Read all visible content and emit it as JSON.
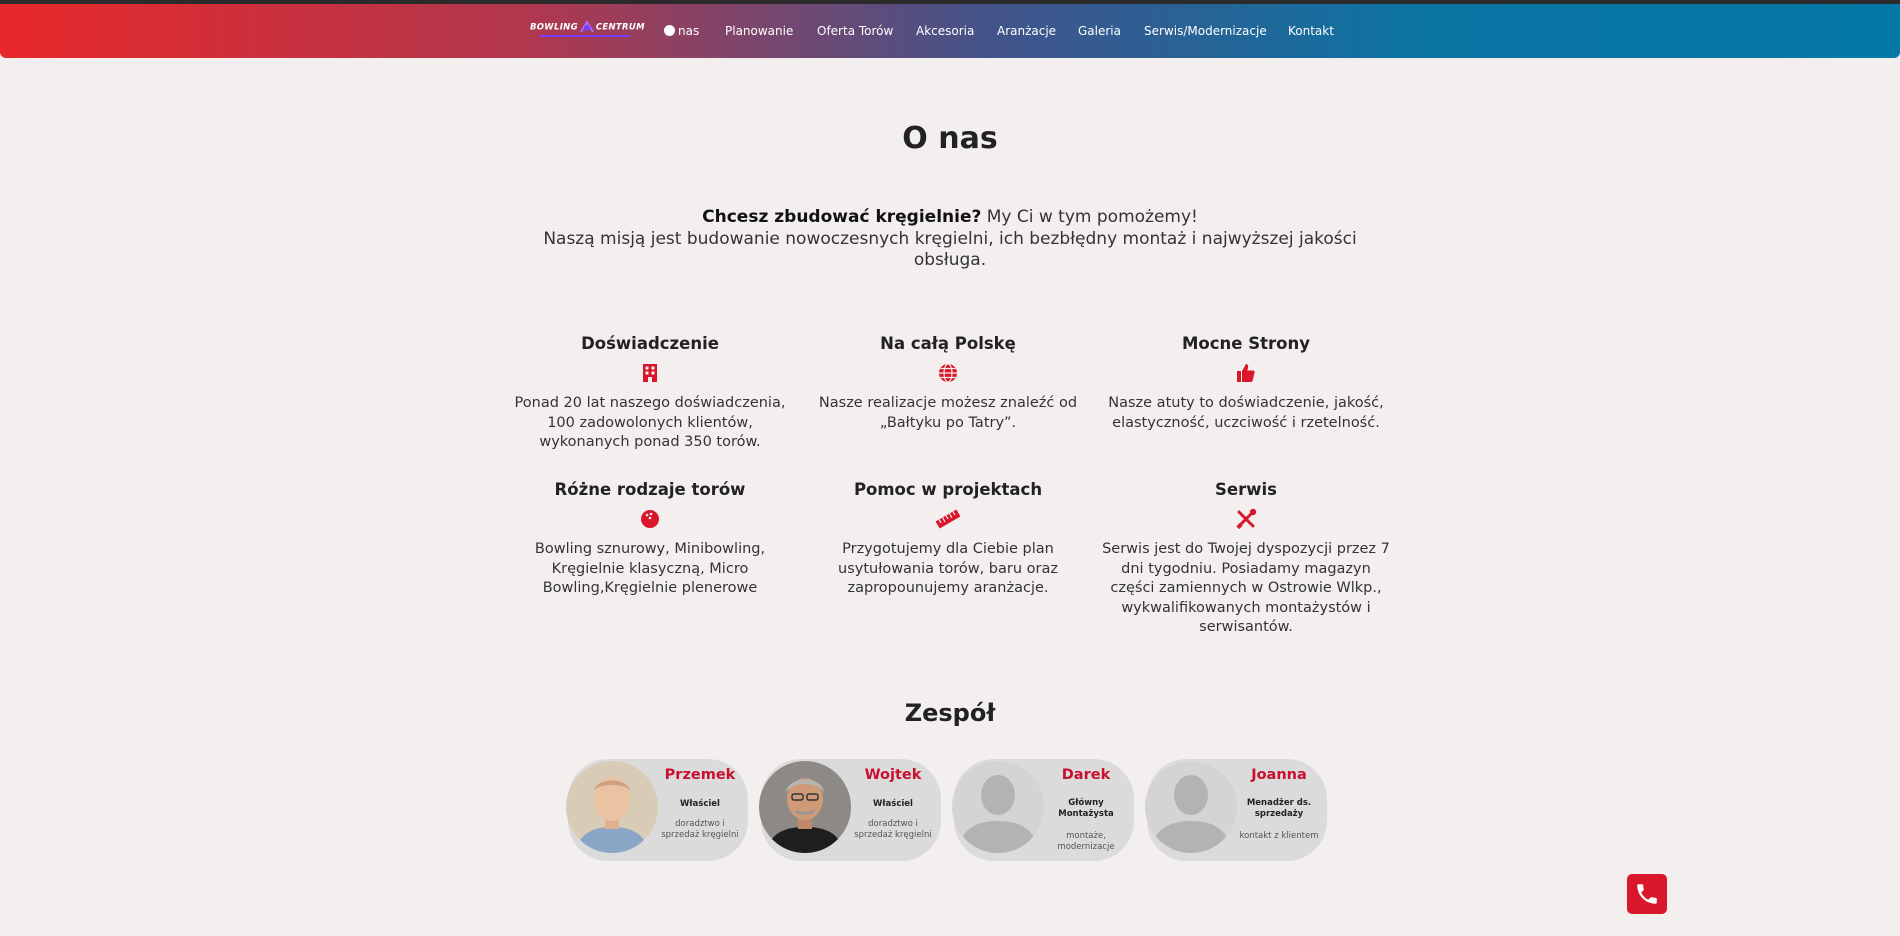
{
  "nav": {
    "logo_left": "BOWLING",
    "logo_right": "CENTRUM",
    "items": [
      "nas",
      "Planowanie",
      "Oferta Torów",
      "Akcesoria",
      "Aranżacje",
      "Galeria",
      "Serwis/Modernizacje",
      "Kontakt"
    ]
  },
  "page_title": "O nas",
  "intro": {
    "bold": "Chcesz zbudować kręgielnie?",
    "rest": " My Ci w tym pomożemy!",
    "line2": "Naszą misją jest budowanie nowoczesnych kręgielni, ich bezbłędny montaż i najwyższej jakości obsługa."
  },
  "features": [
    {
      "title": "Doświadczenie",
      "icon": "building-icon",
      "text": "Ponad 20 lat naszego doświadczenia, 100 zadowolonych klientów, wykonanych ponad 350 torów."
    },
    {
      "title": "Na całą Polskę",
      "icon": "globe-icon",
      "text": "Nasze realizacje możesz znaleźć od „Bałtyku po Tatry”."
    },
    {
      "title": "Mocne Strony",
      "icon": "thumbs-up-icon",
      "text": "Nasze atuty to doświadczenie, jakość, elastyczność, uczciwość i rzetelność."
    },
    {
      "title": "Różne rodzaje torów",
      "icon": "bowling-ball-icon",
      "text": "Bowling sznurowy, Minibowling, Kręgielnie klasyczną, Micro Bowling,Kręgielnie plenerowe"
    },
    {
      "title": "Pomoc w projektach",
      "icon": "ruler-icon",
      "text": "Przygotujemy dla Ciebie plan usytułowania torów, baru oraz zapropounujemy aranżacje."
    },
    {
      "title": "Serwis",
      "icon": "tools-icon",
      "text": "Serwis jest do Twojej dyspozycji przez 7 dni tygodniu. Posiadamy magazyn części zamiennych w Ostrowie Wlkp., wykwalifikowanych montażystów i serwisantów."
    }
  ],
  "team_title": "Zespół",
  "team": [
    {
      "name": "Przemek",
      "role": "Właściel",
      "desc": "doradztwo i sprzedaż kręgielni"
    },
    {
      "name": "Wojtek",
      "role": "Właściel",
      "desc": "doradztwo i sprzedaż kręgielni"
    },
    {
      "name": "Darek",
      "role": "Główny Montażysta",
      "desc": "montaże, modernizacje"
    },
    {
      "name": "Joanna",
      "role": "Menadżer ds. sprzedaży",
      "desc": "kontakt z klientem"
    }
  ],
  "colors": {
    "accent": "#d9162a",
    "name": "#c8102e",
    "nav_start": "#e8282a",
    "nav_end": "#0478a6"
  }
}
